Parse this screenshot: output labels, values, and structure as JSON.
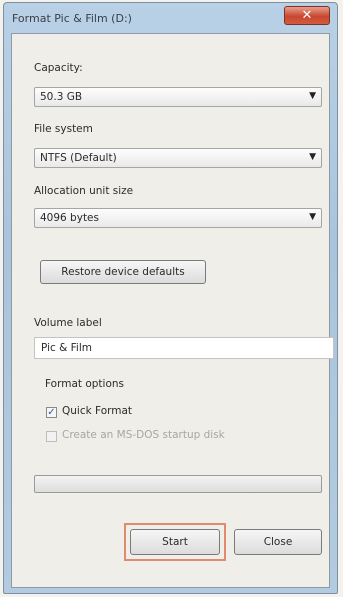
{
  "window": {
    "title": "Format Pic & Film (D:)"
  },
  "capacity": {
    "label": "Capacity:",
    "value": "50.3 GB"
  },
  "file_system": {
    "label": "File system",
    "value": "NTFS (Default)"
  },
  "allocation": {
    "label": "Allocation unit size",
    "value": "4096 bytes"
  },
  "restore_button": "Restore device defaults",
  "volume_label": {
    "label": "Volume label",
    "value": "Pic & Film"
  },
  "format_options": {
    "heading": "Format options",
    "quick_format": {
      "label": "Quick Format",
      "checked": true
    },
    "msdos_disk": {
      "label": "Create an MS-DOS startup disk",
      "checked": false,
      "enabled": false
    }
  },
  "progress": {
    "value": 0
  },
  "buttons": {
    "start": "Start",
    "close": "Close"
  }
}
